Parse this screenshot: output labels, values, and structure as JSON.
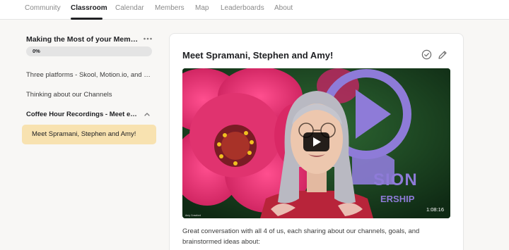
{
  "nav": {
    "tabs": [
      "Community",
      "Classroom",
      "Calendar",
      "Members",
      "Map",
      "Leaderboards",
      "About"
    ],
    "active_tab": "Classroom"
  },
  "sidebar": {
    "course_title": "Making the Most of your Membe...",
    "progress": {
      "label": "0%",
      "value": 0
    },
    "lessons": [
      "Three platforms - Skool, Motion.io, and Dy...",
      "Thinking about our Channels"
    ],
    "section_title": "Coffee Hour Recordings - Meet eac...",
    "active_lesson": "Meet Spramani, Stephen and Amy!"
  },
  "content": {
    "title": "Meet Spramani, Stephen and Amy!",
    "video": {
      "duration": "1:08:16",
      "watermark": "Amy Crawford",
      "logo_line1": "SION",
      "logo_line2": "ERSHIP"
    },
    "description": "Great conversation with all 4 of us, each sharing about our channels, goals, and brainstormed ideas about:"
  },
  "colors": {
    "accent_highlight": "#f8e2b0",
    "brand_purple": "#8e7bd8",
    "flower_pink": "#e0336f"
  },
  "icons": [
    "more-icon",
    "chevron-up-icon",
    "check-circle-icon",
    "pencil-icon",
    "play-icon"
  ]
}
